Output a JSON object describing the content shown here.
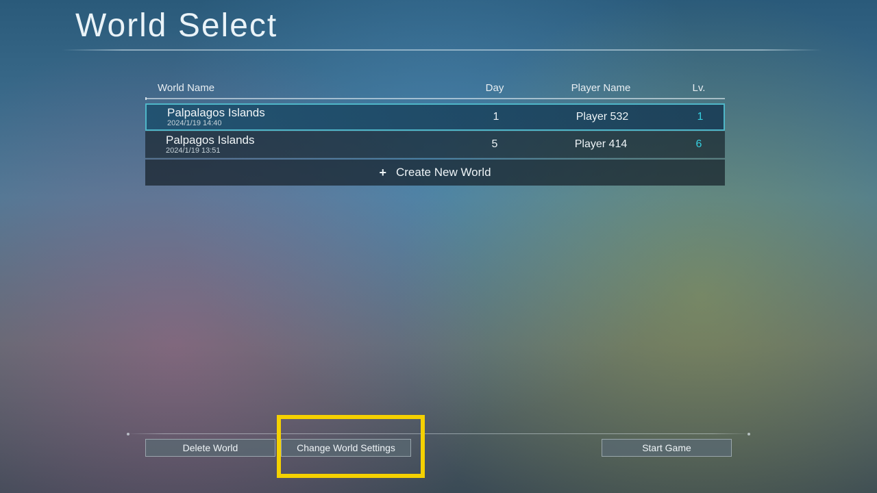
{
  "title": "World Select",
  "columns": {
    "world": "World Name",
    "day": "Day",
    "player": "Player Name",
    "lv": "Lv."
  },
  "worlds": [
    {
      "name": "Palpalagos Islands",
      "timestamp": "2024/1/19 14:40",
      "day": "1",
      "player": "Player 532",
      "lv": "1",
      "selected": true
    },
    {
      "name": "Palpagos Islands",
      "timestamp": "2024/1/19 13:51",
      "day": "5",
      "player": "Player 414",
      "lv": "6",
      "selected": false
    }
  ],
  "create_label": "Create New World",
  "buttons": {
    "delete": "Delete World",
    "change": "Change World Settings",
    "start": "Start Game"
  }
}
